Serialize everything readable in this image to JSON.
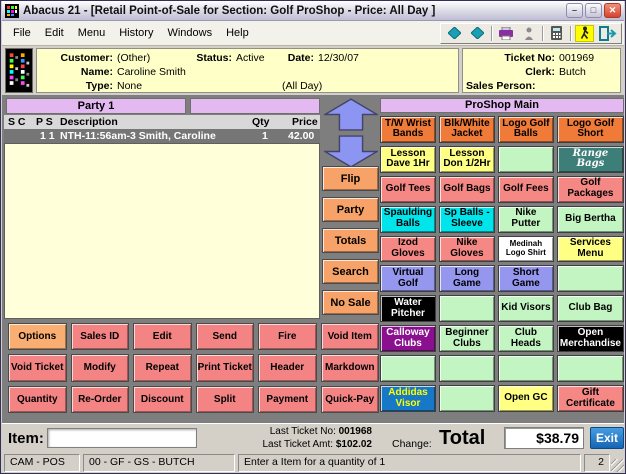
{
  "window": {
    "title": "Abacus 21 - [Retail Point-of-Sale for Section: Golf ProShop - Price: All Day ]"
  },
  "menu": {
    "items": [
      "File",
      "Edit",
      "Menu",
      "History",
      "Windows",
      "Help"
    ]
  },
  "toolbar": {
    "icons": [
      "back-icon",
      "forward-icon",
      "print-icon",
      "clerk-icon",
      "calculator-icon",
      "walkout-icon",
      "exit-door-icon"
    ]
  },
  "customer": {
    "customer_label": "Customer:",
    "customer_value": "(Other)",
    "name_label": "Name:",
    "name_value": "Caroline Smith",
    "type_label": "Type:",
    "type_value": "None",
    "status_label": "Status:",
    "status_value": "Active",
    "date_label": "Date:",
    "date_value": "12/30/07",
    "all_day": "(All Day)",
    "ticket_no_label": "Ticket No:",
    "ticket_no_value": "001969",
    "clerk_label": "Clerk:",
    "clerk_value": "Butch",
    "sales_person_label": "Sales Person:",
    "sales_person_value": ""
  },
  "party": {
    "tab_label": "Party 1",
    "columns": {
      "sc": "S C",
      "ps": "P S",
      "description": "Description",
      "qty": "Qty",
      "price": "Price"
    },
    "row": {
      "flags": "1 1",
      "description": "NTH-11:56am-3 Smith, Caroline",
      "qty": "1",
      "price": "42.00"
    }
  },
  "nav": {
    "buttons": [
      "Flip",
      "Party",
      "Totals",
      "Search",
      "No Sale"
    ]
  },
  "proshop": {
    "header": "ProShop Main",
    "buttons": [
      {
        "label": "T/W Wrist Bands",
        "style": "orange"
      },
      {
        "label": "Blk/White Jacket",
        "style": "orange"
      },
      {
        "label": "Logo Golf Balls",
        "style": "orange"
      },
      {
        "label": "Logo Golf Short",
        "style": "orange"
      },
      {
        "label": "Lesson Dave 1Hr",
        "style": "yellow"
      },
      {
        "label": "Lesson Don 1/2Hr",
        "style": "yellow"
      },
      {
        "label": "",
        "style": "green"
      },
      {
        "label": "Range Bags",
        "style": "teal"
      },
      {
        "label": "Golf Tees",
        "style": "salmon"
      },
      {
        "label": "Golf Bags",
        "style": "salmon"
      },
      {
        "label": "Golf Fees",
        "style": "salmon"
      },
      {
        "label": "Golf Packages",
        "style": "salmon"
      },
      {
        "label": "Spaulding Balls",
        "style": "cyan"
      },
      {
        "label": "Sp Balls - Sleeve",
        "style": "cyan"
      },
      {
        "label": "Nike Putter",
        "style": "green"
      },
      {
        "label": "Big Bertha",
        "style": "green"
      },
      {
        "label": "Izod Gloves",
        "style": "salmon"
      },
      {
        "label": "Nike Gloves",
        "style": "salmon"
      },
      {
        "label": "Medinah Logo Shirt",
        "style": "white",
        "small": true
      },
      {
        "label": "Services Menu",
        "style": "yellow"
      },
      {
        "label": "Virtual Golf",
        "style": "periwinkle"
      },
      {
        "label": "Long Game",
        "style": "periwinkle"
      },
      {
        "label": "Short Game",
        "style": "periwinkle"
      },
      {
        "label": "",
        "style": "green"
      },
      {
        "label": "Water Pitcher",
        "style": "black"
      },
      {
        "label": "",
        "style": "green"
      },
      {
        "label": "Kid Visors",
        "style": "green"
      },
      {
        "label": "Club Bag",
        "style": "green"
      },
      {
        "label": "Calloway Clubs",
        "style": "purple"
      },
      {
        "label": "Beginner Clubs",
        "style": "green"
      },
      {
        "label": "Club Heads",
        "style": "green"
      },
      {
        "label": "Open Merchandise",
        "style": "black"
      },
      {
        "label": "",
        "style": "green"
      },
      {
        "label": "",
        "style": "green"
      },
      {
        "label": "",
        "style": "green"
      },
      {
        "label": "",
        "style": "green"
      },
      {
        "label": "Addidas Visor",
        "style": "blue"
      },
      {
        "label": "",
        "style": "green"
      },
      {
        "label": "Open GC",
        "style": "yellow"
      },
      {
        "label": "Gift Certificate",
        "style": "salmon"
      }
    ]
  },
  "actions": {
    "labels": [
      "Options",
      "Sales ID",
      "Edit",
      "Send",
      "Fire",
      "Void Item",
      "Void Ticket",
      "Modify",
      "Repeat",
      "Print Ticket",
      "Header",
      "Markdown",
      "Quantity",
      "Re-Order",
      "Discount",
      "Split",
      "Payment",
      "Quick-Pay"
    ]
  },
  "item_bar": {
    "item_label": "Item:",
    "item_value": "",
    "last_ticket_no_label": "Last Ticket No:",
    "last_ticket_no_value": "001968",
    "last_ticket_amt_label": "Last Ticket Amt:",
    "last_ticket_amt_value": "$102.02",
    "change_label": "Change:",
    "total_label": "Total",
    "total_value": "$38.79",
    "exit_label": "Exit"
  },
  "status_bar": {
    "segments": [
      "CAM - POS",
      "00 - GF - GS - BUTCH",
      "Enter a Item for a quantity of 1",
      "2"
    ]
  },
  "colors": {
    "orange": "#F07A38",
    "yellow": "#FFFF84",
    "green": "#C3F5C3",
    "salmon": "#F58884",
    "cyan": "#00E4EC",
    "periwinkle": "#9597EF",
    "teal": "#3E7E78",
    "white": "#FFFFFF",
    "black": "#000000",
    "purple": "#8A1090",
    "blue": "#1778C8",
    "nav_button": "#F6A268",
    "action_button": "#F48484",
    "options_button": "#FBAE72",
    "header_lavender": "#E4B9F2",
    "exit_button": "#1874D0"
  },
  "prod_text_colors": {
    "teal": "#FFFFFF",
    "black": "#FFFFFF",
    "purple": "#FFFFFF",
    "blue": "#FFFF00"
  }
}
